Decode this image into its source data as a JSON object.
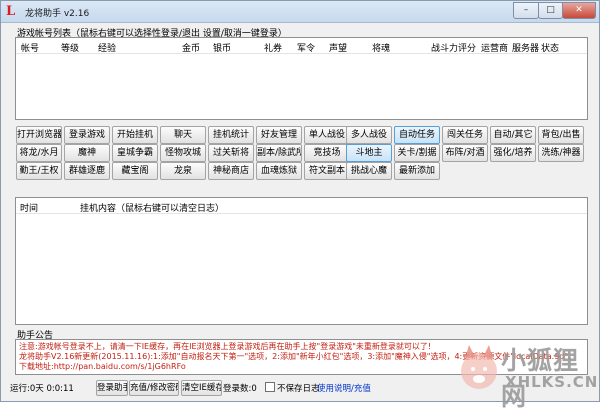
{
  "window": {
    "title": "龙将助手 v2.16",
    "logo_letter": "L"
  },
  "window_buttons": {
    "minimize": "–",
    "maximize": "□",
    "close": "✕"
  },
  "accounts": {
    "label": "游戏帐号列表（鼠标右键可以选择性登录/退出 设置/取消一键登录）",
    "columns": [
      "帐号",
      "等级",
      "经验",
      "金币",
      "银币",
      "礼券",
      "军令",
      "声望",
      "将魂",
      "战斗力评分",
      "运营商",
      "服务器",
      "状态"
    ]
  },
  "actions": {
    "row1": [
      "打开浏览器",
      "登录游戏",
      "开始挂机",
      "聊天",
      "挂机统计",
      "好友管理",
      "单人战役",
      "多人战役",
      "自动任务",
      "闯关任务",
      "自动/其它",
      "背包/出售"
    ],
    "row2": [
      "将龙/水月",
      "魔神",
      "皇城争霸",
      "怪物攻城",
      "过关斩将",
      "副本/除武所",
      "竞技场",
      "斗地主",
      "关卡/割据",
      "布阵/对酒",
      "强化/培养",
      "洗练/神器"
    ],
    "row3": [
      "勤王/王权",
      "群雄逐鹿",
      "藏宝阁",
      "龙泉",
      "神秘商店",
      "血魂炼狱",
      "符文副本",
      "挑战心魔",
      "最新添加"
    ]
  },
  "log": {
    "columns": [
      "时间",
      "挂机内容（鼠标右键可以清空日志）"
    ]
  },
  "notice": {
    "title": "助手公告",
    "lines": [
      "注意:游戏帐号登录不上，请清一下IE缓存，再在IE浏览器上登录游戏后再在助手上按\"登录游戏\"未重新登录就可以了!",
      "龙将助手V2.16新更新(2015.11.16):1:添加\"自动报名天下第一\"选项，2:添加\"新年小红包\"选项，3:添加\"魔神入侵\"选项，4:更新资源文件\"localData.9d\"。",
      "下载地址:http://pan.baidu.com/s/1jG6hRFo"
    ]
  },
  "status": {
    "runtime": "运行:0天 0:0:11",
    "login_assist": "登录助手",
    "recharge": "充值/修改密码",
    "clear_cache": "清空IE缓存",
    "login_count": "登录数:0",
    "no_save_log": "不保存日志",
    "help": "使用说明/充值"
  },
  "watermark": {
    "cn": "小狐狸网",
    "en": "XHLKS.CN"
  },
  "colors": {
    "notice_text": "#c41e10",
    "link": "#0033cc",
    "logo": "#d81e1e"
  }
}
